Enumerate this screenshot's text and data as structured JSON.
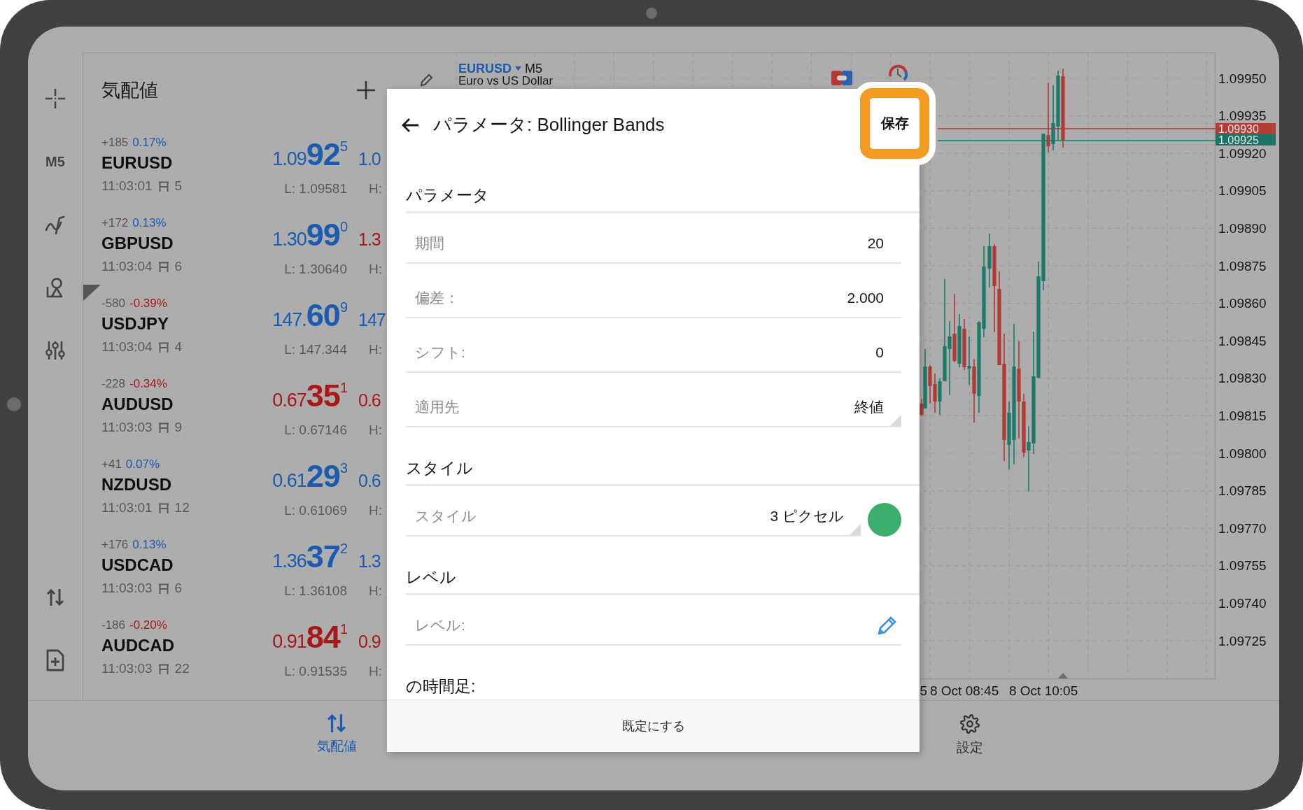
{
  "toolbar": {
    "timeframe": "M5"
  },
  "quotes": {
    "title": "気配値",
    "rows": [
      {
        "change": "+185",
        "change_pct": "0.17%",
        "change_falling": false,
        "symbol": "EURUSD",
        "time": "11:03:01",
        "spread": "5",
        "bid": "1.09**92**$^{5}$",
        "bid_falling": false,
        "ask": "1.0",
        "ask_falling": false,
        "low": "L: 1.09581",
        "high": "H:"
      },
      {
        "change": "+172",
        "change_pct": "0.13%",
        "change_falling": false,
        "symbol": "GBPUSD",
        "time": "11:03:04",
        "spread": "6",
        "bid": "1.30**99**$^{0}$",
        "bid_falling": false,
        "ask": "1.3",
        "ask_falling": true,
        "low": "L: 1.30640",
        "high": "H:"
      },
      {
        "change": "-580",
        "change_pct": "-0.39%",
        "change_falling": true,
        "symbol": "USDJPY",
        "time": "11:03:04",
        "spread": "4",
        "bid": "147.**60**$^{9}$",
        "bid_falling": false,
        "ask": "147",
        "ask_falling": false,
        "low": "L: 147.344",
        "high": "H:"
      },
      {
        "change": "-228",
        "change_pct": "-0.34%",
        "change_falling": true,
        "symbol": "AUDUSD",
        "time": "11:03:03",
        "spread": "9",
        "bid": "0.67**35**$^{1}$",
        "bid_falling": true,
        "ask": "0.6",
        "ask_falling": true,
        "low": "L: 0.67146",
        "high": "H:"
      },
      {
        "change": "+41",
        "change_pct": "0.07%",
        "change_falling": false,
        "symbol": "NZDUSD",
        "time": "11:03:01",
        "spread": "12",
        "bid": "0.61**29**$^{3}$",
        "bid_falling": false,
        "ask": "0.6",
        "ask_falling": false,
        "low": "L: 0.61069",
        "high": "H:"
      },
      {
        "change": "+176",
        "change_pct": "0.13%",
        "change_falling": false,
        "symbol": "USDCAD",
        "time": "11:03:03",
        "spread": "6",
        "bid": "1.36**37**$^{2}$",
        "bid_falling": false,
        "ask": "1.3",
        "ask_falling": false,
        "low": "L: 1.36108",
        "high": "H:"
      },
      {
        "change": "-186",
        "change_pct": "-0.20%",
        "change_falling": true,
        "symbol": "AUDCAD",
        "time": "11:03:03",
        "spread": "22",
        "bid": "0.91**84**$^{1}$",
        "bid_falling": true,
        "ask": "0.9",
        "ask_falling": true,
        "low": "L: 0.91535",
        "high": "H:"
      }
    ]
  },
  "chart": {
    "symbol": "EURUSD",
    "timeframe": "M5",
    "description": "Euro vs US Dollar",
    "price_axis": [
      "1.09950",
      "1.09935",
      "1.09920",
      "1.09905",
      "1.09890",
      "1.09875",
      "1.09860",
      "1.09845",
      "1.09830",
      "1.09815",
      "1.09800",
      "1.09785",
      "1.09770",
      "1.09755",
      "1.09740",
      "1.09725"
    ],
    "bid_tag": "1.09930",
    "ask_tag": "1.09925",
    "time_axis": [
      "5",
      "8 Oct 08:45",
      "8 Oct 10:05"
    ]
  },
  "dialog": {
    "title": "パラメータ: Bollinger Bands",
    "save": "保存",
    "save_highlighted": true,
    "sections": [
      {
        "title": "パラメータ",
        "fields": [
          {
            "kind": "number",
            "label": "期間",
            "value": "20"
          },
          {
            "kind": "number",
            "label": "偏差：",
            "value": "2.000"
          },
          {
            "kind": "number",
            "label": "シフト:",
            "value": "0"
          },
          {
            "kind": "select",
            "label": "適用先",
            "value": "終値"
          }
        ]
      },
      {
        "title": "スタイル",
        "fields": [
          {
            "kind": "line_style",
            "label": "スタイル",
            "value": "3 ピクセル",
            "color": "#3caf6e"
          }
        ]
      },
      {
        "title": "レベル",
        "fields": [
          {
            "kind": "levels",
            "label": "レベル:"
          }
        ]
      },
      {
        "title": "の時間足:"
      }
    ],
    "footer_button": "既定にする"
  },
  "bottom_nav": [
    {
      "kind": "quotes",
      "label": "気配値",
      "selected": true
    },
    {
      "kind": "settings",
      "label": "設定",
      "selected": false
    }
  ]
}
